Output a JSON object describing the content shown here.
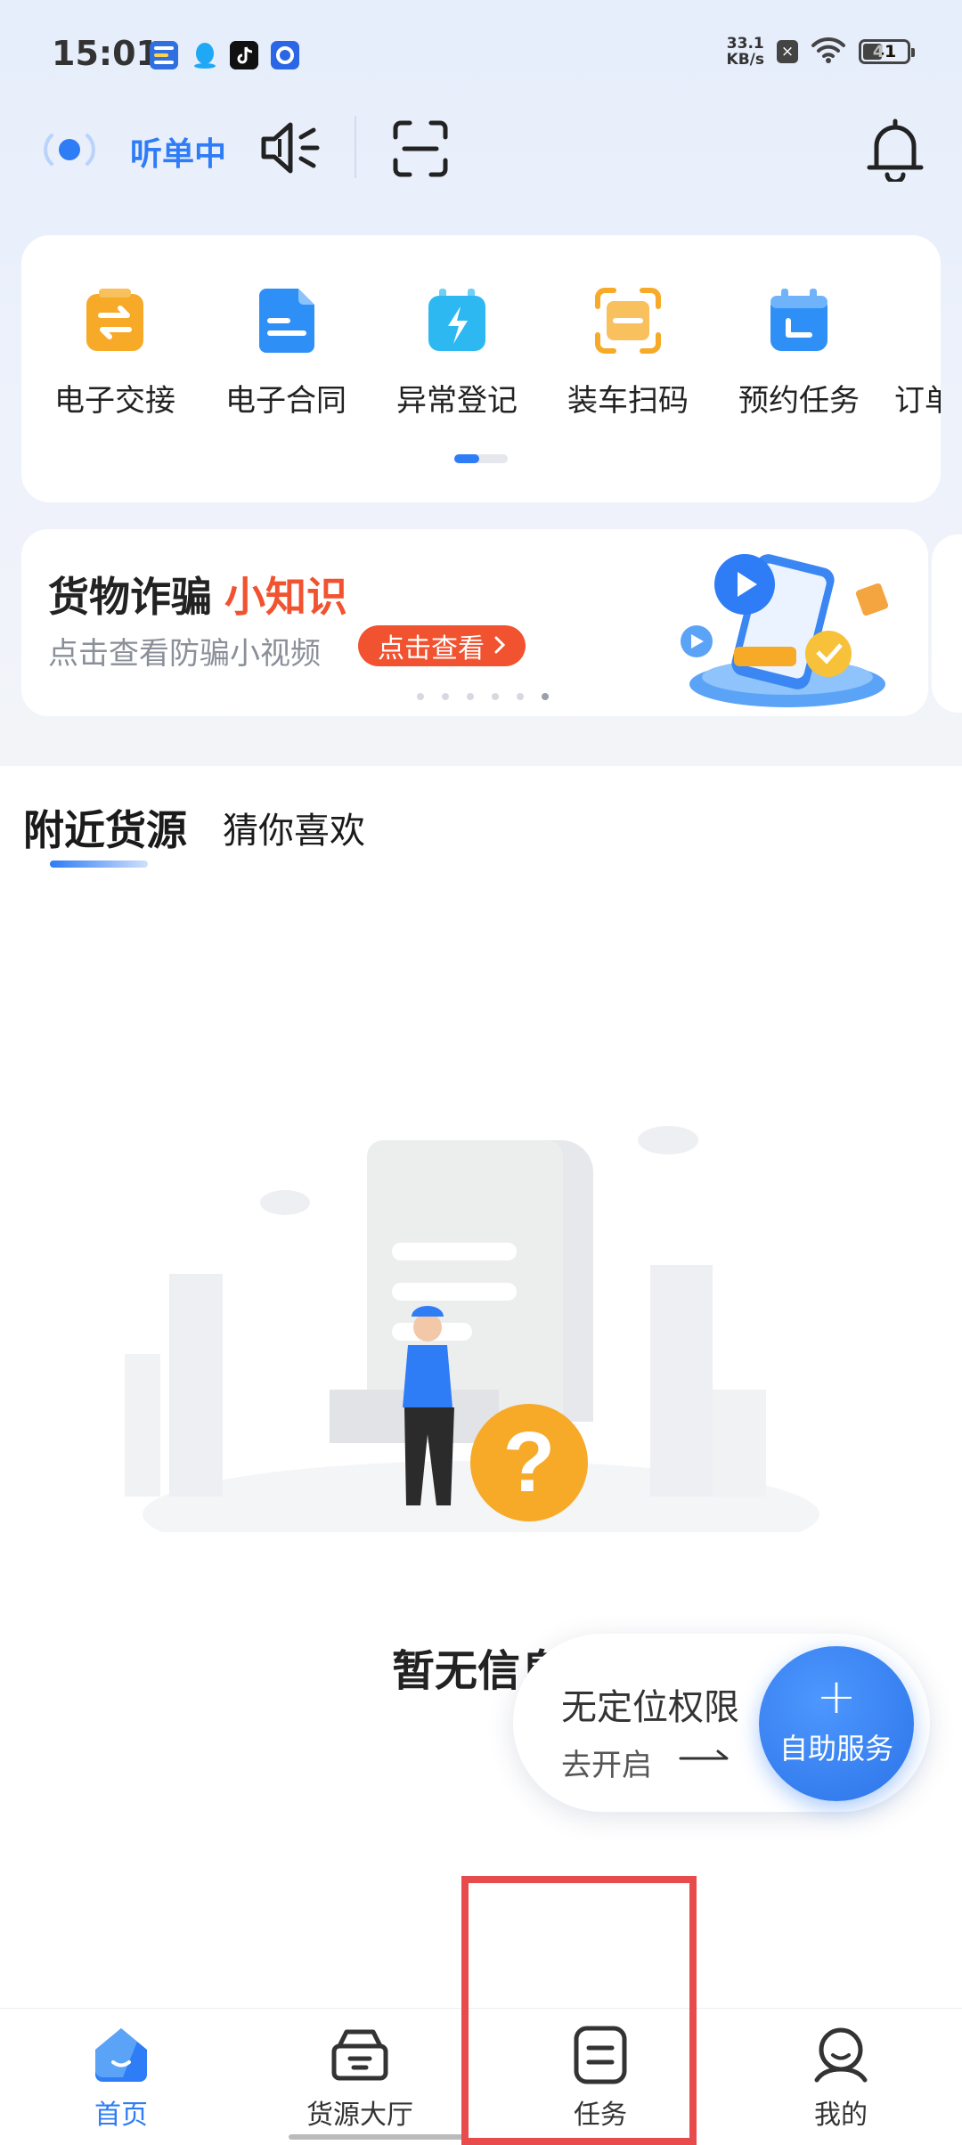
{
  "status_bar": {
    "time": "15:01",
    "net_speed_value": "33.1",
    "net_speed_unit": "KB/s",
    "battery": "41",
    "app_icons": [
      "app-a-icon",
      "qq-icon",
      "tiktok-icon",
      "app-b-icon"
    ]
  },
  "header": {
    "listening_label": "听单中",
    "colors": {
      "accent": "#2e7cf6"
    }
  },
  "quick_actions": [
    {
      "label": "电子交接",
      "icon": "handover-icon",
      "color": "#f7a928"
    },
    {
      "label": "电子合同",
      "icon": "contract-icon",
      "color": "#2e90f6"
    },
    {
      "label": "异常登记",
      "icon": "exception-icon",
      "color": "#2eb8f2"
    },
    {
      "label": "装车扫码",
      "icon": "scan-load-icon",
      "color": "#f7a928"
    },
    {
      "label": "预约任务",
      "icon": "reservation-icon",
      "color": "#2e90f6"
    },
    {
      "label": "订单",
      "icon": "order-icon",
      "color": "#2e90f6"
    }
  ],
  "banner": {
    "title": "货物诈骗",
    "title_accent": "小知识",
    "subtitle": "点击查看防骗小视频",
    "button_label": "点击查看",
    "colors": {
      "accent": "#f1522f"
    }
  },
  "tabs": [
    {
      "label": "附近货源",
      "active": true
    },
    {
      "label": "猜你喜欢",
      "active": false
    }
  ],
  "empty_state": {
    "message": "暂无信息"
  },
  "location_prompt": {
    "title": "无定位权限",
    "action": "去开启"
  },
  "fab": {
    "label": "自助服务"
  },
  "bottom_nav": [
    {
      "label": "首页",
      "icon": "home-icon",
      "active": true
    },
    {
      "label": "货源大厅",
      "icon": "cargo-hall-icon",
      "active": false
    },
    {
      "label": "任务",
      "icon": "task-icon",
      "active": false
    },
    {
      "label": "我的",
      "icon": "profile-icon",
      "active": false
    }
  ]
}
